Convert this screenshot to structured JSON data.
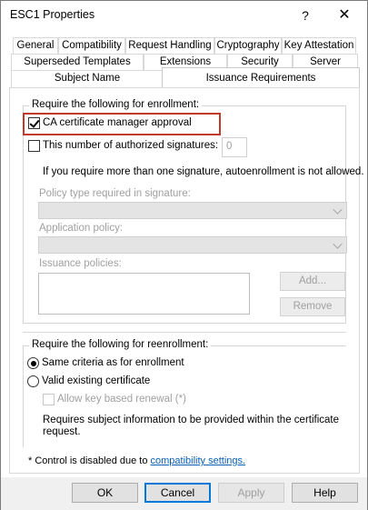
{
  "window": {
    "title": "ESC1 Properties",
    "help_glyph": "?",
    "close_glyph": "✕"
  },
  "tabs": {
    "row1": [
      "General",
      "Compatibility",
      "Request Handling",
      "Cryptography",
      "Key Attestation"
    ],
    "row2": [
      "Superseded Templates",
      "Extensions",
      "Security",
      "Server"
    ],
    "row3": [
      "Subject Name",
      "Issuance Requirements"
    ],
    "active": "Issuance Requirements"
  },
  "enrollment": {
    "group_label": "Require the following for enrollment:",
    "ca_approval_label": "CA certificate manager approval",
    "ca_approval_checked": true,
    "signatures_label": "This number of authorized signatures:",
    "signatures_checked": false,
    "signatures_value": "0",
    "autoenroll_note": "If you require more than one signature, autoenrollment is not allowed.",
    "policy_type_label": "Policy type required in signature:",
    "application_policy_label": "Application policy:",
    "issuance_policies_label": "Issuance policies:",
    "add_button": "Add...",
    "remove_button": "Remove"
  },
  "reenrollment": {
    "group_label": "Require the following for reenrollment:",
    "same_criteria_label": "Same criteria as for enrollment",
    "valid_cert_label": "Valid existing certificate",
    "selected": "same_criteria",
    "allow_key_renewal_label": "Allow key based renewal (*)",
    "subject_info_note_line1": "Requires subject information to be provided within the certificate",
    "subject_info_note_line2": "request."
  },
  "footnote": {
    "prefix": "* Control is disabled due to ",
    "link_text": "compatibility settings."
  },
  "buttons": {
    "ok": "OK",
    "cancel": "Cancel",
    "apply": "Apply",
    "help": "Help"
  },
  "colors": {
    "highlight": "#c0392b",
    "link": "#0a5fb4",
    "default_button_border": "#0078d7"
  }
}
